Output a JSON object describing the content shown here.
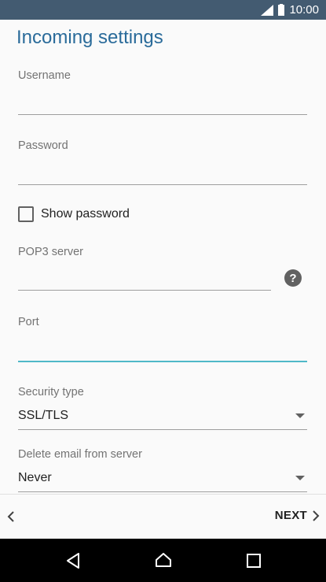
{
  "status_bar": {
    "time": "10:00",
    "icons": [
      "signal-icon",
      "battery-icon"
    ]
  },
  "page": {
    "title": "Incoming settings"
  },
  "fields": {
    "username": {
      "label": "Username",
      "value": ""
    },
    "password": {
      "label": "Password",
      "value": ""
    },
    "show_password": {
      "label": "Show password",
      "checked": false
    },
    "pop3_server": {
      "label": "POP3 server",
      "value": "",
      "help_icon": "help-icon"
    },
    "port": {
      "label": "Port",
      "value": ""
    },
    "security_type": {
      "label": "Security type",
      "value": "SSL/TLS"
    },
    "delete_email": {
      "label": "Delete email from server",
      "value": "Never"
    }
  },
  "bottom_bar": {
    "next_label": "NEXT"
  },
  "nav_bar": {
    "buttons": [
      "back-icon",
      "home-icon",
      "recents-icon"
    ]
  },
  "colors": {
    "status_bar": "#435b71",
    "title": "#2a6b9a",
    "active_line": "#4fb8c8"
  }
}
